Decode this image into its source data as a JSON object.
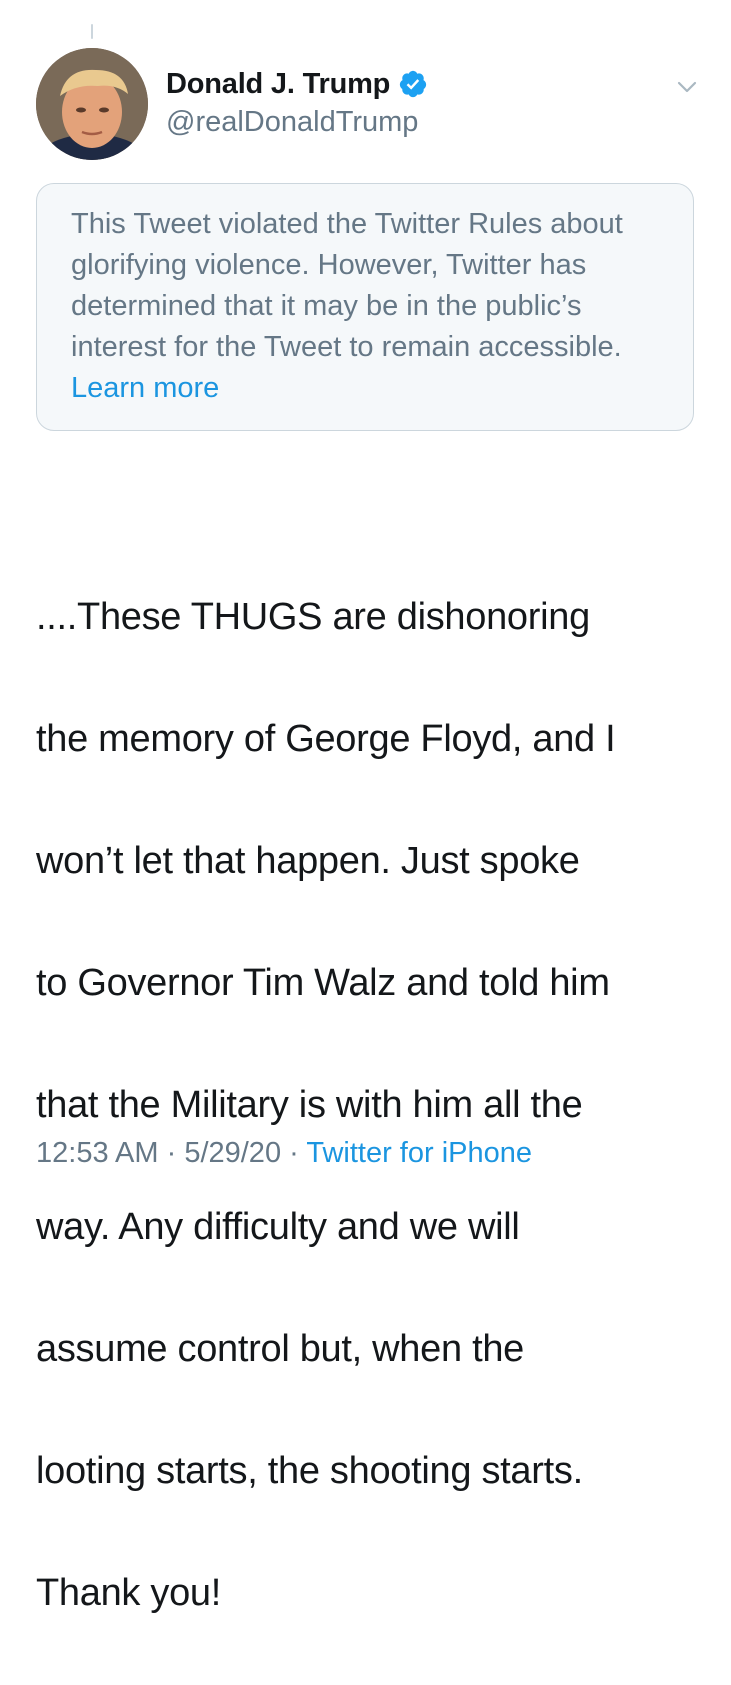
{
  "author": {
    "display_name": "Donald J. Trump",
    "handle": "@realDonaldTrump",
    "verified": true,
    "avatar_icon": "user-avatar-photo"
  },
  "notice": {
    "text": "This Tweet violated the Twitter Rules about glorifying violence. However, Twitter has determined that it may be in the public’s interest for the Tweet to remain accessible.",
    "link_label": "Learn more"
  },
  "tweet": {
    "lines": [
      "....These THUGS are dishonoring",
      "the memory of George Floyd, and I",
      "won’t let that happen. Just spoke",
      "to Governor Tim Walz and told him",
      "that the Military is with him all the",
      "way. Any difficulty and we will",
      "assume control but, when the",
      "looting starts, the shooting starts.",
      "Thank you!"
    ]
  },
  "meta": {
    "time": "12:53 AM",
    "separator": "·",
    "date": "5/29/20",
    "source": "Twitter for iPhone"
  },
  "colors": {
    "link": "#1b95e0",
    "secondary_text": "#657786",
    "notice_background": "#f5f8fa",
    "notice_border": "#ccd6dd"
  },
  "icons": [
    "verified-badge-icon",
    "chevron-down-icon"
  ]
}
